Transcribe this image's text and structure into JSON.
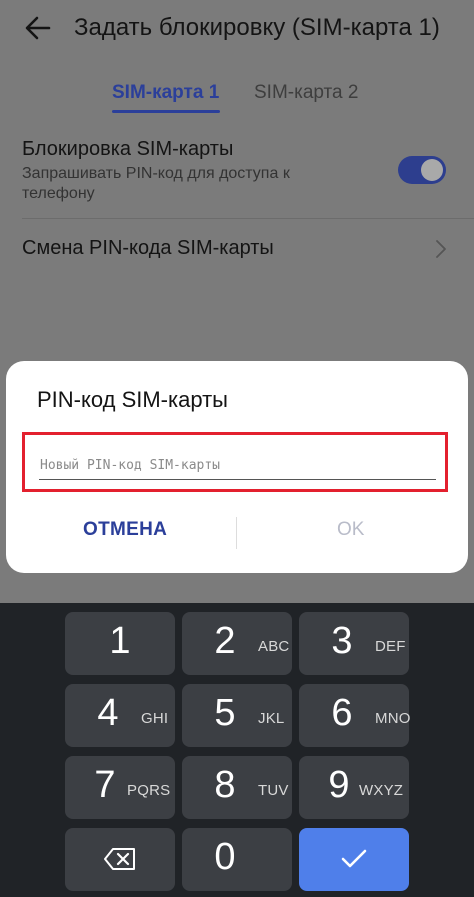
{
  "header": {
    "title": "Задать блокировку (SIM-карта 1)"
  },
  "tabs": [
    {
      "label": "SIM-карта 1"
    },
    {
      "label": "SIM-карта 2"
    }
  ],
  "settings": {
    "sim_lock": {
      "title": "Блокировка SIM-карты",
      "subtitle": "Запрашивать PIN-код для доступа к телефону",
      "enabled": true
    },
    "change_pin": {
      "title": "Смена PIN-кода SIM-карты"
    }
  },
  "dialog": {
    "title": "PIN-код SIM-карты",
    "input_placeholder": "Новый PIN-код SIM-карты",
    "cancel_label": "ОТМЕНА",
    "ok_label": "OK"
  },
  "keypad": {
    "keys": [
      {
        "digit": "1",
        "letters": ""
      },
      {
        "digit": "2",
        "letters": "ABC"
      },
      {
        "digit": "3",
        "letters": "DEF"
      },
      {
        "digit": "4",
        "letters": "GHI"
      },
      {
        "digit": "5",
        "letters": "JKL"
      },
      {
        "digit": "6",
        "letters": "MNO"
      },
      {
        "digit": "7",
        "letters": "PQRS"
      },
      {
        "digit": "8",
        "letters": "TUV"
      },
      {
        "digit": "9",
        "letters": "WXYZ"
      },
      {
        "digit": "0",
        "letters": ""
      }
    ],
    "backspace_icon": "backspace-icon",
    "confirm_icon": "checkmark-icon"
  },
  "colors": {
    "accent": "#2b3f9a",
    "highlight": "#e3202e",
    "confirm": "#4f7fea"
  }
}
